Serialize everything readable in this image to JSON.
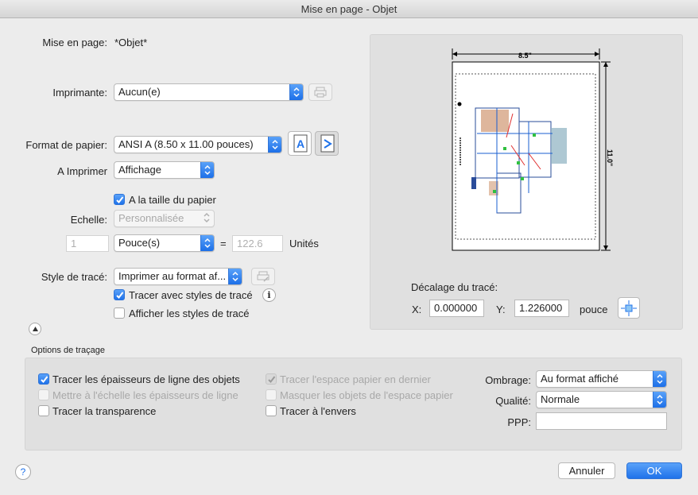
{
  "window": {
    "title": "Mise en page - Objet"
  },
  "layout": {
    "label": "Mise en page:",
    "value": "*Objet*"
  },
  "printer": {
    "label": "Imprimante:",
    "selected": "Aucun(e)",
    "properties_icon": "printer-properties-icon"
  },
  "paper": {
    "label": "Format de papier:",
    "selected": "ANSI A (8.50 x 11.00 pouces)",
    "portrait_icon": "portrait-orientation-icon",
    "landscape_icon": "landscape-orientation-icon"
  },
  "plot_area": {
    "label": "A Imprimer",
    "selected": "Affichage"
  },
  "fit_to_paper": {
    "label": "A la taille du papier",
    "checked": true
  },
  "scale": {
    "label": "Echelle:",
    "selected": "Personnalisée",
    "value1": "1",
    "unit_selected": "Pouce(s)",
    "equals": "=",
    "value2": "122.6",
    "units_label": "Unités"
  },
  "plot_style": {
    "label": "Style de tracé:",
    "selected": "Imprimer au format af...",
    "edit_icon": "edit-plot-style-icon",
    "plot_with_styles": {
      "label": "Tracer avec styles de tracé",
      "checked": true
    },
    "info_glyph": "i",
    "show_styles": {
      "label": "Afficher les styles de tracé",
      "checked": false
    }
  },
  "collapse_icon": "collapse-triangle-icon",
  "preview": {
    "width_label": "8.5\"",
    "height_label": "11.0\"",
    "offset_label": "Décalage du tracé:",
    "x_label": "X:",
    "x_value": "0.000000",
    "y_label": "Y:",
    "y_value": "1.226000",
    "unit": "pouce",
    "center_icon": "center-plot-icon"
  },
  "options": {
    "title": "Options de traçage",
    "lineweights": {
      "label": "Tracer les épaisseurs de ligne des objets",
      "checked": true,
      "enabled": true
    },
    "scale_lineweights": {
      "label": "Mettre à l'échelle les épaisseurs de ligne",
      "checked": false,
      "enabled": false
    },
    "transparency": {
      "label": "Tracer la transparence",
      "checked": false,
      "enabled": true
    },
    "paperspace_last": {
      "label": "Tracer l'espace papier en dernier",
      "checked": true,
      "enabled": false
    },
    "hide_paperspace": {
      "label": "Masquer les objets de l'espace papier",
      "checked": false,
      "enabled": false
    },
    "upside_down": {
      "label": "Tracer à l'envers",
      "checked": false,
      "enabled": true
    },
    "shade": {
      "label": "Ombrage:",
      "selected": "Au format affiché"
    },
    "quality": {
      "label": "Qualité:",
      "selected": "Normale"
    },
    "dpi": {
      "label": "PPP:",
      "value": ""
    }
  },
  "help": {
    "glyph": "?"
  },
  "buttons": {
    "cancel": "Annuler",
    "ok": "OK"
  },
  "colors": {
    "accent": "#1f72ea",
    "background": "#ececec"
  }
}
